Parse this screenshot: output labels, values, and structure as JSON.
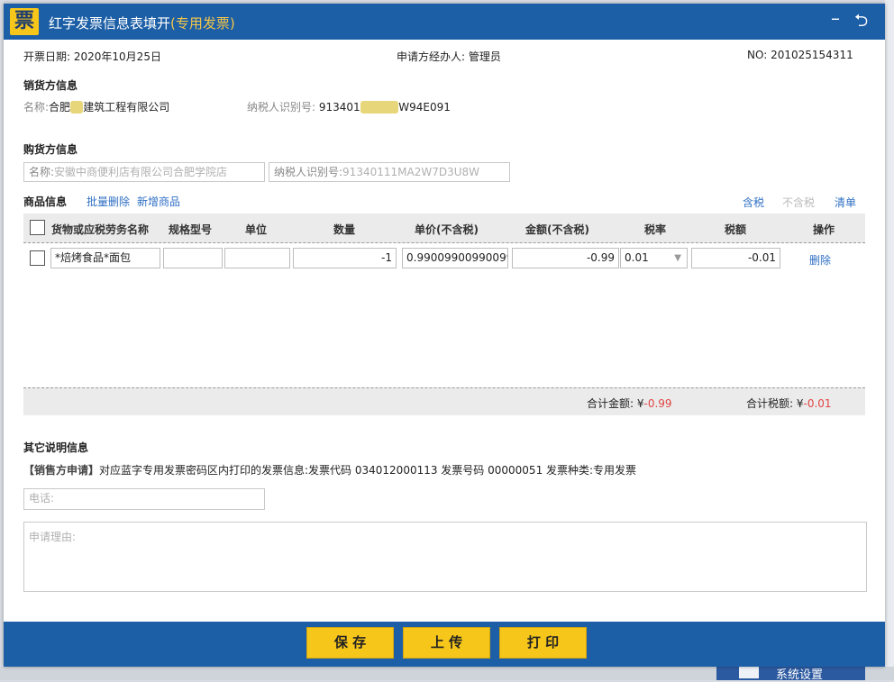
{
  "window": {
    "title_main": "红字发票信息表填开",
    "title_note": "(专用发票)",
    "logo_char": "票",
    "minimize_icon": "–",
    "restore_icon": "⮌"
  },
  "header": {
    "date_label": "开票日期:",
    "date_value": "2020年10月25日",
    "agent_label": "申请方经办人:",
    "agent_value": "管理员",
    "no_label": "NO:",
    "no_value": "201025154311"
  },
  "seller": {
    "section_title": "销货方信息",
    "name_label": "名称:",
    "name_prefix": "合肥",
    "name_blurred": "xx",
    "name_suffix": "建筑工程有限公司",
    "tax_label": "纳税人识别号:",
    "tax_prefix": "913401",
    "tax_blurred": "xxxxxx",
    "tax_suffix": "W94E091"
  },
  "buyer": {
    "section_title": "购货方信息",
    "name_label": "名称:",
    "name_value": "安徽中商便利店有限公司合肥学院店",
    "tax_label": "纳税人识别号:",
    "tax_value": "91340111MA2W7D3U8W"
  },
  "goods": {
    "section_title": "商品信息",
    "batch_delete": "批量删除",
    "add_item": "新增商品",
    "tax_incl": "含税",
    "tax_excl": "不含税",
    "list_link": "清单",
    "columns": [
      "货物或应税劳务名称",
      "规格型号",
      "单位",
      "数量",
      "单价(不含税)",
      "金额(不含税)",
      "税率",
      "税额",
      "操作"
    ],
    "rows": [
      {
        "name": "*焙烤食品*面包",
        "spec": "",
        "unit": "",
        "qty": "-1",
        "price": "0.990099009900990",
        "amount": "-0.99",
        "rate": "0.01",
        "tax": "-0.01",
        "action": "删除"
      }
    ],
    "total_amount_label": "合计金额:",
    "total_amount_currency": "¥",
    "total_amount_value": "-0.99",
    "total_tax_label": "合计税额:",
    "total_tax_currency": "¥",
    "total_tax_value": "-0.01"
  },
  "other": {
    "section_title": "其它说明信息",
    "applicant_tag": "【销售方申请】",
    "description": "对应蓝字专用发票密码区内打印的发票信息:发票代码 034012000113 发票号码 00000051 发票种类:专用发票",
    "phone_placeholder": "电话:",
    "reason_placeholder": "申请理由:"
  },
  "actions": {
    "save": "保 存",
    "upload": "上 传",
    "print": "打 印"
  },
  "background": {
    "settings_label": "系统设置"
  },
  "colors": {
    "titlebar": "#1d5fa6",
    "button": "#f6c61b",
    "link": "#2f6fc4",
    "negative": "#e04545"
  }
}
